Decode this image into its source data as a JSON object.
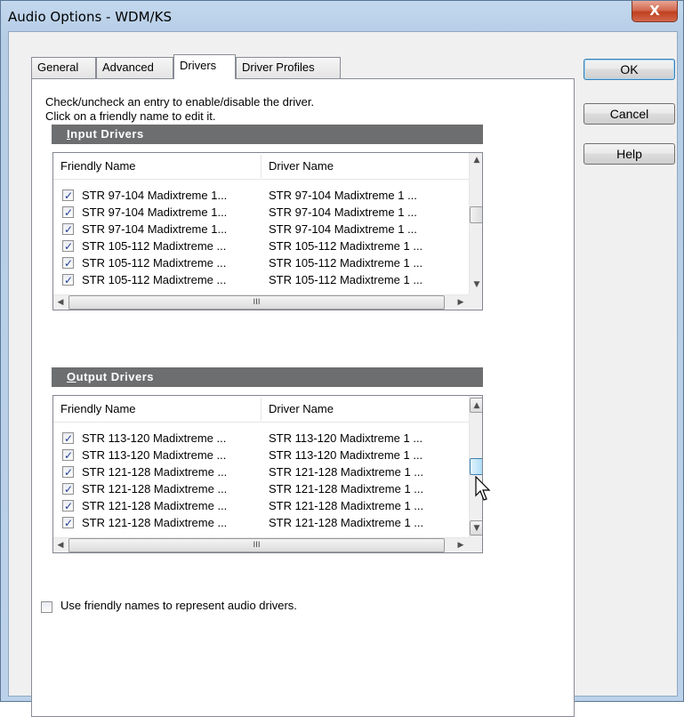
{
  "window": {
    "title": "Audio Options - WDM/KS",
    "close_glyph": "X"
  },
  "tabs": [
    {
      "label": "General",
      "active": false
    },
    {
      "label": "Advanced",
      "active": false
    },
    {
      "label": "Drivers",
      "active": true
    },
    {
      "label": "Driver Profiles",
      "active": false
    }
  ],
  "instructions": {
    "line1": "Check/uncheck an entry to enable/disable the driver.",
    "line2": "Click on a friendly name to edit it."
  },
  "input_drivers": {
    "header_mnemonic": "I",
    "header_rest": "nput Drivers",
    "columns": [
      "Friendly Name",
      "Driver Name"
    ],
    "rows": [
      {
        "checked": true,
        "friendly": "STR 97-104 Madixtreme 1...",
        "driver": "STR 97-104 Madixtreme 1 ..."
      },
      {
        "checked": true,
        "friendly": "STR 97-104 Madixtreme 1...",
        "driver": "STR 97-104 Madixtreme 1 ..."
      },
      {
        "checked": true,
        "friendly": "STR 97-104 Madixtreme 1...",
        "driver": "STR 97-104 Madixtreme 1 ..."
      },
      {
        "checked": true,
        "friendly": "STR 105-112 Madixtreme ...",
        "driver": "STR 105-112 Madixtreme 1 ..."
      },
      {
        "checked": true,
        "friendly": "STR 105-112 Madixtreme ...",
        "driver": "STR 105-112 Madixtreme 1 ..."
      },
      {
        "checked": true,
        "friendly": "STR 105-112 Madixtreme ...",
        "driver": "STR 105-112 Madixtreme 1 ..."
      }
    ]
  },
  "output_drivers": {
    "header_mnemonic": "O",
    "header_rest": "utput Drivers",
    "columns": [
      "Friendly Name",
      "Driver Name"
    ],
    "rows": [
      {
        "checked": true,
        "friendly": "STR 113-120 Madixtreme ...",
        "driver": "STR 113-120 Madixtreme 1 ..."
      },
      {
        "checked": true,
        "friendly": "STR 113-120 Madixtreme ...",
        "driver": "STR 113-120 Madixtreme 1 ..."
      },
      {
        "checked": true,
        "friendly": "STR 121-128 Madixtreme ...",
        "driver": "STR 121-128 Madixtreme 1 ..."
      },
      {
        "checked": true,
        "friendly": "STR 121-128 Madixtreme ...",
        "driver": "STR 121-128 Madixtreme 1 ..."
      },
      {
        "checked": true,
        "friendly": "STR 121-128 Madixtreme ...",
        "driver": "STR 121-128 Madixtreme 1 ..."
      },
      {
        "checked": true,
        "friendly": "STR 121-128 Madixtreme ...",
        "driver": "STR 121-128 Madixtreme 1 ..."
      }
    ]
  },
  "scroll_glyphs": {
    "up": "▲",
    "down": "▼",
    "left": "◀",
    "right": "▶",
    "grip": "III"
  },
  "friendly_names_option": {
    "label": "Use friendly names to represent audio drivers.",
    "checked": false
  },
  "buttons": {
    "ok": "OK",
    "cancel": "Cancel",
    "help": "Help"
  },
  "icons": {
    "checkmark": "check-icon",
    "cursor": "mouse-pointer-icon"
  }
}
